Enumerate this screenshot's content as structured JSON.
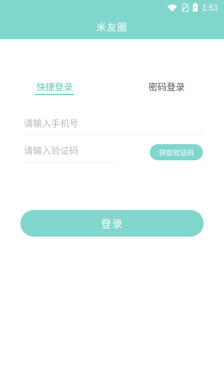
{
  "status_bar": {
    "time": "1:51",
    "icons": [
      "wifi-icon",
      "no-sim-icon",
      "battery-icon"
    ],
    "color": "#80d6cc"
  },
  "app_bar": {
    "title": "米友圈"
  },
  "tabs": {
    "quick_login": "快捷登录",
    "password_login": "密码登录",
    "active": "quick_login"
  },
  "form": {
    "phone_placeholder": "请输入手机号",
    "code_placeholder": "请输入验证码",
    "get_code_label": "获取验证码",
    "login_label": "登录"
  },
  "colors": {
    "accent": "#80d6cc",
    "active_tab_text": "#62c9bd",
    "placeholder": "#b9b9b9"
  }
}
